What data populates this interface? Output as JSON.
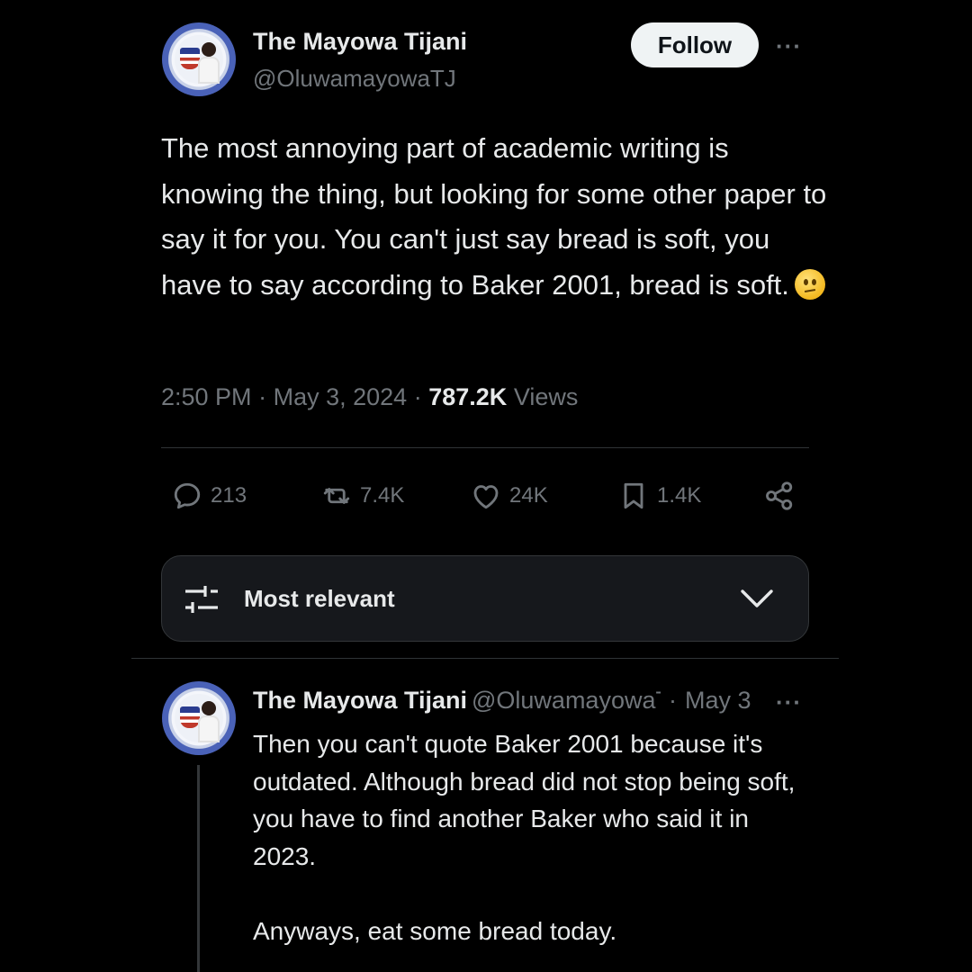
{
  "tweet": {
    "author_name": "The Mayowa Tijani",
    "author_handle": "@OluwamayowaTJ",
    "follow_label": "Follow",
    "more_label": "···",
    "text": "The most annoying part of academic writing is knowing the thing, but looking for some other paper to say it for you. You can't just say bread is soft, you have to say according to Baker 2001, bread is soft.",
    "emoji": "confused-face-emoji",
    "time": "2:50 PM",
    "date": "May 3, 2024",
    "views_count": "787.2K",
    "views_label": "Views",
    "separator": "·"
  },
  "actions": {
    "replies": "213",
    "reposts": "7.4K",
    "likes": "24K",
    "bookmarks": "1.4K"
  },
  "sort": {
    "label": "Most relevant"
  },
  "reply": {
    "author_name": "The Mayowa Tijani",
    "author_handle": "@OluwamayowaTJ",
    "date": "May 3",
    "separator": "·",
    "more_label": "···",
    "text": "Then you can't quote Baker 2001 because it's outdated. Although bread did not stop being soft, you have to find another Baker who said it in 2023.\n\nAnyways, eat some bread today."
  },
  "colors": {
    "background": "#000000",
    "text_primary": "#e7e9ea",
    "text_secondary": "#71767b",
    "follow_button_bg": "#eff3f4",
    "divider": "#2f3336"
  }
}
